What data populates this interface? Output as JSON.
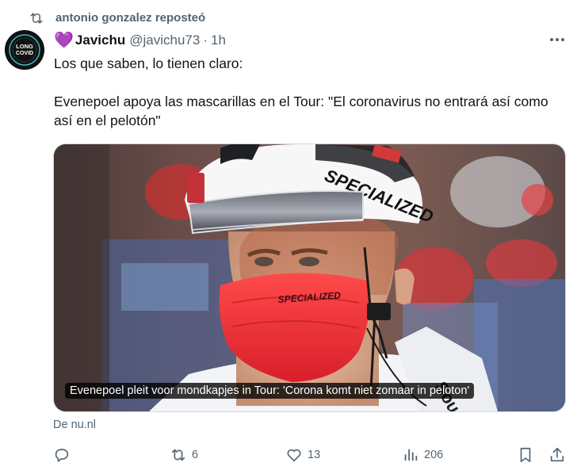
{
  "repost": {
    "text": "antonio gonzalez reposteó",
    "icon": "repost-icon"
  },
  "author": {
    "name": "Javichu",
    "handle": "@javichu73",
    "separator": "·",
    "time": "1h",
    "badge_emoji": "💜",
    "avatar_text": {
      "top": "LONG",
      "bottom": "COVID"
    }
  },
  "tweet": {
    "paragraphs": [
      "Los que saben, lo tienen claro:",
      "Evenepoel apoya las mascarillas en el Tour: \"El coronavirus no entrará así como así en el pelotón\""
    ]
  },
  "card": {
    "caption": "Evenepoel pleit voor mondkapjes in Tour: 'Corona komt niet zomaar in peloton'",
    "source": "De nu.nl",
    "helmet_text": "SPECIALIZED",
    "mask_text": "SPECIALIZED"
  },
  "actions": {
    "reply": {
      "icon": "reply-icon",
      "count": ""
    },
    "repost": {
      "icon": "repost-icon",
      "count": "6"
    },
    "like": {
      "icon": "heart-icon",
      "count": "13"
    },
    "views": {
      "icon": "views-icon",
      "count": "206"
    },
    "bookmark": {
      "icon": "bookmark-icon"
    },
    "share": {
      "icon": "share-icon"
    }
  },
  "colors": {
    "secondary_text": "#536471",
    "primary_text": "#0f1419",
    "border": "#cfd9de",
    "heart_purple": "#9b6fd6"
  }
}
